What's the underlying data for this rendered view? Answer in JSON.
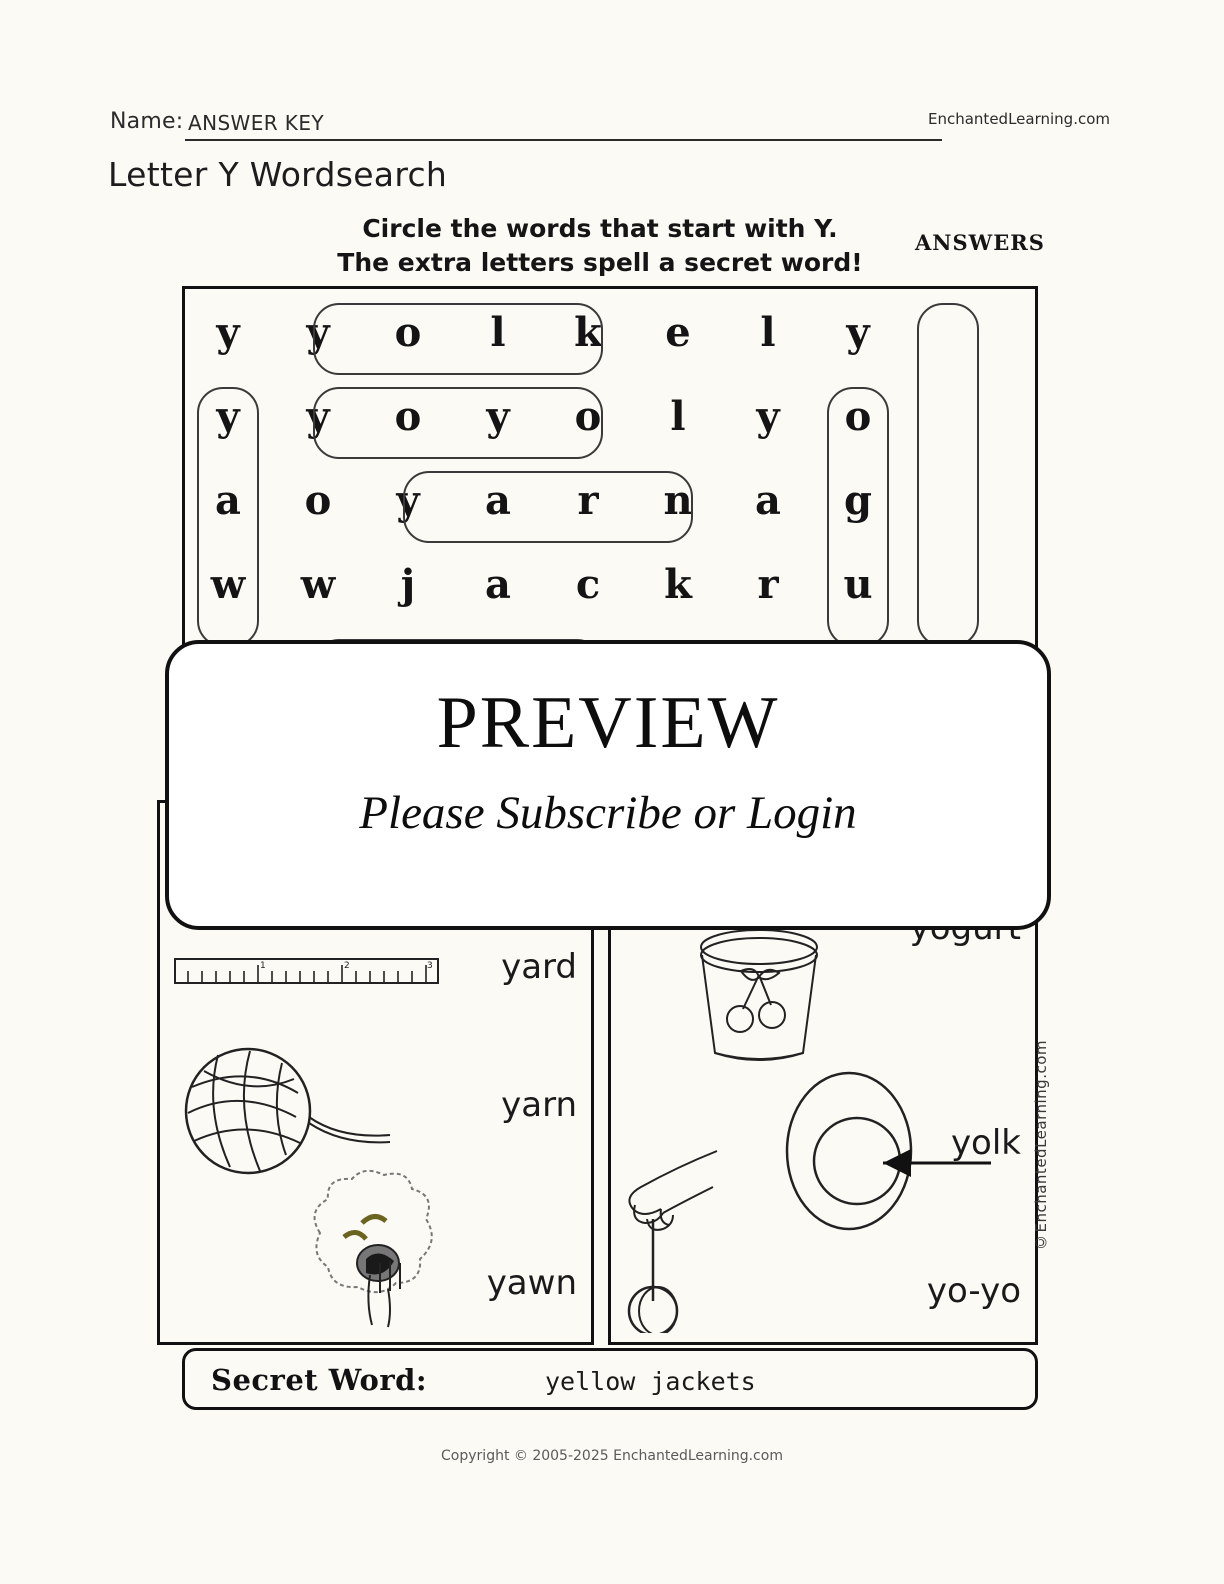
{
  "header": {
    "name_label": "Name:",
    "name_value": "ANSWER KEY",
    "brand": "EnchantedLearning.com"
  },
  "title": "Letter Y Wordsearch",
  "instructions": {
    "line1": "Circle the words that start with Y.",
    "line2": "The extra letters spell a secret word!",
    "answers_tag": "ANSWERS"
  },
  "wordsearch": {
    "columns": 8,
    "rows": 6,
    "grid": [
      [
        "y",
        "y",
        "o",
        "l",
        "k",
        "e",
        "l",
        "y"
      ],
      [
        "y",
        "y",
        "o",
        "y",
        "o",
        "l",
        "y",
        "o"
      ],
      [
        "a",
        "o",
        "y",
        "a",
        "r",
        "n",
        "a",
        "g"
      ],
      [
        "w",
        "w",
        "j",
        "a",
        "c",
        "k",
        "r",
        "u"
      ],
      [
        "",
        "",
        "",
        "",
        "",
        "",
        "",
        ""
      ],
      [
        "",
        "",
        "",
        "",
        "",
        "",
        "",
        ""
      ]
    ],
    "found_words": [
      "yolk",
      "yo-yo",
      "yarn",
      "yard",
      "yogurt",
      "yawn",
      "yarn"
    ]
  },
  "pictures": {
    "left": [
      {
        "word": "yard",
        "icon": "ruler-icon"
      },
      {
        "word": "yarn",
        "icon": "yarn-ball-icon"
      },
      {
        "word": "yawn",
        "icon": "yawning-face-icon"
      }
    ],
    "right": [
      {
        "word": "yogurt",
        "icon": "yogurt-cup-icon"
      },
      {
        "word": "yolk",
        "icon": "egg-yolk-icon"
      },
      {
        "word": "yo-yo",
        "icon": "yoyo-icon"
      }
    ]
  },
  "secret": {
    "label": "Secret Word:",
    "value": "yellow jackets"
  },
  "watermark": "©EnchantedLearning.com",
  "footer": "Copyright © 2005-2025 EnchantedLearning.com",
  "preview": {
    "title": "PREVIEW",
    "subtitle": "Please Subscribe or Login"
  },
  "colors": {
    "page_bg": "#fbfaf4",
    "ink": "#111111",
    "ring": "#3a3a3a"
  }
}
